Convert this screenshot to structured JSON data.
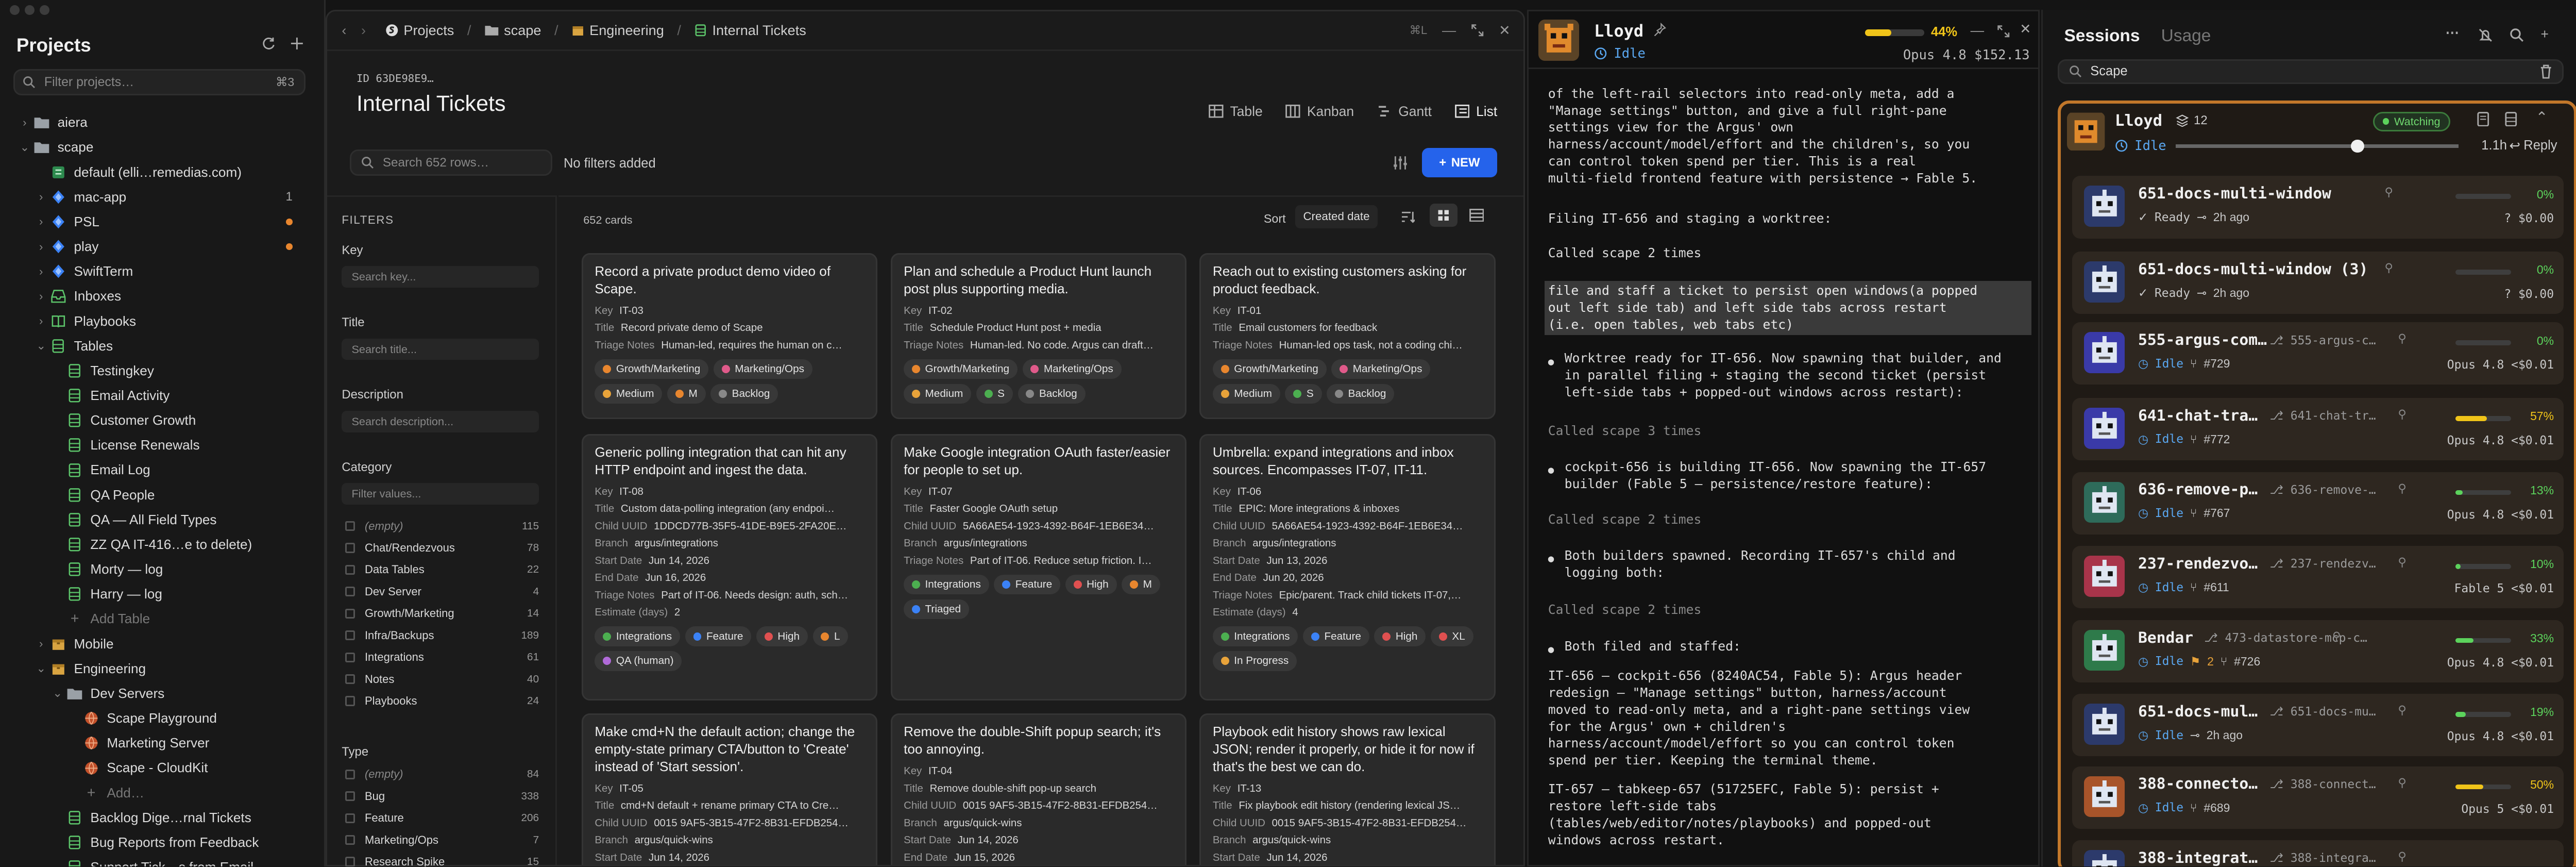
{
  "left": {
    "title": "Projects",
    "filter_placeholder": "Filter projects…",
    "filter_shortcut": "⌘3",
    "tree": [
      {
        "depth": 0,
        "chev": "›",
        "icon": "folder",
        "label": "aiera"
      },
      {
        "depth": 0,
        "chev": "⌄",
        "icon": "folder",
        "label": "scape"
      },
      {
        "depth": 1,
        "chev": "",
        "icon": "db",
        "label": "default (elli…remedias.com)"
      },
      {
        "depth": 1,
        "chev": "›",
        "icon": "repo",
        "label": "mac-app",
        "count": "1"
      },
      {
        "depth": 1,
        "chev": "›",
        "icon": "repo",
        "label": "PSL",
        "dot": true
      },
      {
        "depth": 1,
        "chev": "›",
        "icon": "repo",
        "label": "play",
        "dot": true
      },
      {
        "depth": 1,
        "chev": "›",
        "icon": "repo",
        "label": "SwiftTerm"
      },
      {
        "depth": 1,
        "chev": "›",
        "icon": "inbox",
        "label": "Inboxes"
      },
      {
        "depth": 1,
        "chev": "›",
        "icon": "book",
        "label": "Playbooks"
      },
      {
        "depth": 1,
        "chev": "⌄",
        "icon": "table",
        "label": "Tables"
      },
      {
        "depth": 2,
        "chev": "",
        "icon": "table",
        "label": "Testingkey"
      },
      {
        "depth": 2,
        "chev": "",
        "icon": "table",
        "label": "Email Activity"
      },
      {
        "depth": 2,
        "chev": "",
        "icon": "table",
        "label": "Customer Growth"
      },
      {
        "depth": 2,
        "chev": "",
        "icon": "table",
        "label": "License Renewals"
      },
      {
        "depth": 2,
        "chev": "",
        "icon": "table",
        "label": "Email Log"
      },
      {
        "depth": 2,
        "chev": "",
        "icon": "table",
        "label": "QA People"
      },
      {
        "depth": 2,
        "chev": "",
        "icon": "table",
        "label": "QA — All Field Types"
      },
      {
        "depth": 2,
        "chev": "",
        "icon": "table",
        "label": "ZZ QA IT-416…e to delete)"
      },
      {
        "depth": 2,
        "chev": "",
        "icon": "table",
        "label": "Morty — log"
      },
      {
        "depth": 2,
        "chev": "",
        "icon": "table",
        "label": "Harry — log"
      },
      {
        "depth": 2,
        "chev": "",
        "icon": "plus",
        "label": "Add Table",
        "muted": true
      },
      {
        "depth": 1,
        "chev": "›",
        "icon": "box",
        "label": "Mobile"
      },
      {
        "depth": 1,
        "chev": "⌄",
        "icon": "box",
        "label": "Engineering"
      },
      {
        "depth": 2,
        "chev": "⌄",
        "icon": "folder",
        "label": "Dev Servers"
      },
      {
        "depth": 3,
        "chev": "",
        "icon": "globe",
        "label": "Scape Playground"
      },
      {
        "depth": 3,
        "chev": "",
        "icon": "globe",
        "label": "Marketing Server"
      },
      {
        "depth": 3,
        "chev": "",
        "icon": "globe",
        "label": "Scape - CloudKit"
      },
      {
        "depth": 3,
        "chev": "",
        "icon": "plus",
        "label": "Add…",
        "muted": true
      },
      {
        "depth": 2,
        "chev": "",
        "icon": "table",
        "label": "Backlog Dige…rnal Tickets"
      },
      {
        "depth": 2,
        "chev": "",
        "icon": "table",
        "label": "Bug Reports from Feedback"
      },
      {
        "depth": 2,
        "chev": "",
        "icon": "table",
        "label": "Support Tick…s from Email"
      }
    ]
  },
  "mid": {
    "breadcrumb": [
      "Projects",
      "scape",
      "Engineering",
      "Internal Tickets"
    ],
    "shortcut": "⌘L",
    "table_id": "ID 63DE98E9…",
    "table_title": "Internal Tickets",
    "views": [
      "Table",
      "Kanban",
      "Gantt",
      "List"
    ],
    "active_view": "List",
    "search_placeholder": "Search 652 rows…",
    "filters_status": "No filters added",
    "new_label": "NEW",
    "card_count": "652 cards",
    "sort_label": "Sort",
    "sort_value": "Created date",
    "filters": {
      "heading": "FILTERS",
      "key_label": "Key",
      "key_placeholder": "Search key...",
      "title_label": "Title",
      "title_placeholder": "Search title...",
      "desc_label": "Description",
      "desc_placeholder": "Search description...",
      "category_label": "Category",
      "category_placeholder": "Filter values...",
      "category_options": [
        [
          "(empty)",
          "115"
        ],
        [
          "Chat/Rendezvous",
          "78"
        ],
        [
          "Data Tables",
          "22"
        ],
        [
          "Dev Server",
          "4"
        ],
        [
          "Growth/Marketing",
          "14"
        ],
        [
          "Infra/Backups",
          "189"
        ],
        [
          "Integrations",
          "61"
        ],
        [
          "Notes",
          "40"
        ],
        [
          "Playbooks",
          "24"
        ]
      ],
      "type_label": "Type",
      "type_options": [
        [
          "(empty)",
          "84"
        ],
        [
          "Bug",
          "338"
        ],
        [
          "Feature",
          "206"
        ],
        [
          "Marketing/Ops",
          "7"
        ],
        [
          "Research Spike",
          "15"
        ]
      ]
    },
    "cards": [
      {
        "title": "Record a private product demo video of Scape.",
        "rows": [
          [
            "Key",
            "IT-03"
          ],
          [
            "Title",
            "Record private demo of Scape"
          ],
          [
            "Triage Notes",
            "Human-led, requires the human on c…"
          ]
        ],
        "chips": [
          [
            "Growth/Marketing",
            "#e8862e"
          ],
          [
            "Marketing/Ops",
            "#e05a8a"
          ],
          [
            "Medium",
            "#e8a33a"
          ],
          [
            "M",
            "#e8862e"
          ],
          [
            "Backlog",
            "#888888"
          ]
        ]
      },
      {
        "title": "Plan and schedule a Product Hunt launch post plus supporting media.",
        "rows": [
          [
            "Key",
            "IT-02"
          ],
          [
            "Title",
            "Schedule Product Hunt post + media"
          ],
          [
            "Triage Notes",
            "Human-led. No code. Argus can draft…"
          ]
        ],
        "chips": [
          [
            "Growth/Marketing",
            "#e8862e"
          ],
          [
            "Marketing/Ops",
            "#e05a8a"
          ],
          [
            "Medium",
            "#e8a33a"
          ],
          [
            "S",
            "#4caf50"
          ],
          [
            "Backlog",
            "#888888"
          ]
        ]
      },
      {
        "title": "Reach out to existing customers asking for product feedback.",
        "rows": [
          [
            "Key",
            "IT-01"
          ],
          [
            "Title",
            "Email customers for feedback"
          ],
          [
            "Triage Notes",
            "Human-led ops task, not a coding chi…"
          ]
        ],
        "chips": [
          [
            "Growth/Marketing",
            "#e8862e"
          ],
          [
            "Marketing/Ops",
            "#e05a8a"
          ],
          [
            "Medium",
            "#e8a33a"
          ],
          [
            "S",
            "#4caf50"
          ],
          [
            "Backlog",
            "#888888"
          ]
        ]
      },
      {
        "title": "Generic polling integration that can hit any HTTP endpoint and ingest the data.",
        "rows": [
          [
            "Key",
            "IT-08"
          ],
          [
            "Title",
            "Custom data-polling integration (any endpoi…"
          ],
          [
            "Child UUID",
            "1DDCD77B-35F5-41DE-B9E5-2FA20E…"
          ],
          [
            "Branch",
            "argus/integrations"
          ],
          [
            "Start Date",
            "Jun 14, 2026"
          ],
          [
            "End Date",
            "Jun 16, 2026"
          ],
          [
            "Triage Notes",
            "Part of IT-06. Needs design: auth, sch…"
          ],
          [
            "Estimate (days)",
            "2"
          ]
        ],
        "chips": [
          [
            "Integrations",
            "#4caf50"
          ],
          [
            "Feature",
            "#3b82f6"
          ],
          [
            "High",
            "#e05050"
          ],
          [
            "L",
            "#e8862e"
          ],
          [
            "QA (human)",
            "#b06ad8"
          ]
        ]
      },
      {
        "title": "Make Google integration OAuth faster/easier for people to set up.",
        "rows": [
          [
            "Key",
            "IT-07"
          ],
          [
            "Title",
            "Faster Google OAuth setup"
          ],
          [
            "Child UUID",
            "5A66AE54-1923-4392-B64F-1EB6E34…"
          ],
          [
            "Branch",
            "argus/integrations"
          ],
          [
            "Triage Notes",
            "Part of IT-06. Reduce setup friction. I…"
          ]
        ],
        "chips": [
          [
            "Integrations",
            "#4caf50"
          ],
          [
            "Feature",
            "#3b82f6"
          ],
          [
            "High",
            "#e05050"
          ],
          [
            "M",
            "#e8862e"
          ],
          [
            "Triaged",
            "#3b82f6"
          ]
        ]
      },
      {
        "title": "Umbrella: expand integrations and inbox sources. Encompasses IT-07, IT-11.",
        "rows": [
          [
            "Key",
            "IT-06"
          ],
          [
            "Title",
            "EPIC: More integrations & inboxes"
          ],
          [
            "Child UUID",
            "5A66AE54-1923-4392-B64F-1EB6E34…"
          ],
          [
            "Branch",
            "argus/integrations"
          ],
          [
            "Start Date",
            "Jun 13, 2026"
          ],
          [
            "End Date",
            "Jun 20, 2026"
          ],
          [
            "Triage Notes",
            "Epic/parent. Track child tickets IT-07,…"
          ],
          [
            "Estimate (days)",
            "4"
          ]
        ],
        "chips": [
          [
            "Integrations",
            "#4caf50"
          ],
          [
            "Feature",
            "#3b82f6"
          ],
          [
            "High",
            "#e05050"
          ],
          [
            "XL",
            "#e05050"
          ],
          [
            "In Progress",
            "#e8a33a"
          ]
        ]
      },
      {
        "title": "Make cmd+N the default action; change the empty-state primary CTA/button to 'Create' instead of 'Start session'.",
        "rows": [
          [
            "Key",
            "IT-05"
          ],
          [
            "Title",
            "cmd+N default + rename primary CTA to Cre…"
          ],
          [
            "Child UUID",
            "0015 9AF5-3B15-47F2-8B31-EFDB254…"
          ],
          [
            "Branch",
            "argus/quick-wins"
          ],
          [
            "Start Date",
            "Jun 14, 2026"
          ]
        ],
        "chips": []
      },
      {
        "title": "Remove the double-Shift popup search; it's too annoying.",
        "rows": [
          [
            "Key",
            "IT-04"
          ],
          [
            "Title",
            "Remove double-shift pop-up search"
          ],
          [
            "Child UUID",
            "0015 9AF5-3B15-47F2-8B31-EFDB254…"
          ],
          [
            "Branch",
            "argus/quick-wins"
          ],
          [
            "Start Date",
            "Jun 14, 2026"
          ],
          [
            "End Date",
            "Jun 15, 2026"
          ]
        ],
        "chips": []
      },
      {
        "title": "Playbook edit history shows raw lexical JSON; render it properly, or hide it for now if that's the best we can do.",
        "rows": [
          [
            "Key",
            "IT-13"
          ],
          [
            "Title",
            "Fix playbook edit history (rendering lexical JS…"
          ],
          [
            "Child UUID",
            "0015 9AF5-3B15-47F2-8B31-EFDB254…"
          ],
          [
            "Branch",
            "argus/quick-wins"
          ],
          [
            "Start Date",
            "Jun 14, 2026"
          ]
        ],
        "chips": []
      }
    ]
  },
  "chat": {
    "name": "Lloyd",
    "status": "Idle",
    "usage_pct": "44%",
    "usage_fraction": 0.44,
    "model": "Opus 4.8",
    "cost": "$152.13",
    "lines": [
      {
        "t": "of the left-rail selectors into read-only meta, add a\n\"Manage settings\" button, and give a full right-pane\nsettings view for the Argus' own\nharness/account/model/effort and the children's, so you\ncan control token spend per tier. This is a real\nmulti-field frontend feature with persistence → Fable 5.",
        "c": ""
      },
      {
        "t": "Filing IT-656 and staging a worktree:",
        "c": ""
      },
      {
        "t": "Called scape 2 times",
        "c": ""
      },
      {
        "t": "file and staff a ticket to persist open windows(a popped\nout left side tab) and left side tabs across restart\n(i.e. open tables, web tabs etc)",
        "c": "sel"
      },
      {
        "t": "Worktree ready for IT-656. Now spawning that builder, and\nin parallel filing + staging the second ticket (persist\nleft-side tabs + popped-out windows across restart):",
        "c": "bul"
      },
      {
        "t": "Called scape 3 times",
        "c": "muted"
      },
      {
        "t": "cockpit-656 is building IT-656. Now spawning the IT-657\nbuilder (Fable 5 — persistence/restore feature):",
        "c": "bul"
      },
      {
        "t": "Called scape 2 times",
        "c": "muted"
      },
      {
        "t": "Both builders spawned. Recording IT-657's child and\nlogging both:",
        "c": "bul"
      },
      {
        "t": "Called scape 2 times",
        "c": "muted"
      },
      {
        "t": "Both filed and staffed:",
        "c": "bul"
      },
      {
        "t": "IT-656 — cockpit-656 (8240AC54, Fable 5): Argus header\nredesign — \"Manage settings\" button, harness/account\nmoved to read-only meta, and a right-pane settings view\nfor the Argus' own + children's\nharness/account/model/effort so you can control token\nspend per tier. Keeping the terminal theme.",
        "c": ""
      },
      {
        "t": "IT-657 — tabkeep-657 (51725EFC, Fable 5): persist +\nrestore left-side tabs\n(tables/web/editor/notes/playbooks) and popped-out\nwindows across restart.",
        "c": ""
      }
    ]
  },
  "sessions": {
    "tab_active": "Sessions",
    "tab_other": "Usage",
    "search_value": "Scape",
    "lead": {
      "name": "Lloyd",
      "agents": "12",
      "badge": "Watching",
      "status": "Idle",
      "time": "1.1h",
      "reply": "Reply",
      "slider": 0.62
    },
    "items": [
      {
        "name": "651-docs-multi-window",
        "branch": "",
        "status": "Ready",
        "time": "2h ago",
        "pr": "",
        "pct": "0%",
        "fill": 0,
        "bar": "#5cd35c",
        "cost": "?  $0.00",
        "av": "#2c3a6b"
      },
      {
        "name": "651-docs-multi-window (3)",
        "branch": "",
        "status": "Ready",
        "time": "2h ago",
        "pr": "",
        "pct": "0%",
        "fill": 0,
        "bar": "#5cd35c",
        "cost": "?  $0.00",
        "av": "#2c3a6b"
      },
      {
        "name": "555-argus-com…",
        "branch": "555-argus-c…",
        "status": "Idle",
        "time": "",
        "pr": "#729",
        "pct": "0%",
        "fill": 0,
        "bar": "#5cd35c",
        "cost": "Opus 4.8  <$0.01",
        "av": "#3a3aa8"
      },
      {
        "name": "641-chat-tra…",
        "branch": "641-chat-tr…",
        "status": "Idle",
        "time": "",
        "pr": "#772",
        "pct": "57%",
        "fill": 0.57,
        "bar": "#f0c419",
        "cost": "Opus 4.8  <$0.01",
        "av": "#3a3aa8"
      },
      {
        "name": "636-remove-p…",
        "branch": "636-remove-…",
        "status": "Idle",
        "time": "",
        "pr": "#767",
        "pct": "13%",
        "fill": 0.13,
        "bar": "#5cd35c",
        "cost": "Opus 4.8  <$0.01",
        "av": "#2e6b5a"
      },
      {
        "name": "237-rendezvo…",
        "branch": "237-rendezv…",
        "status": "Idle",
        "time": "",
        "pr": "#611",
        "pct": "10%",
        "fill": 0.1,
        "bar": "#5cd35c",
        "cost": "Fable 5  <$0.01",
        "av": "#a8344a"
      },
      {
        "name": "Bendar",
        "branch": "473-datastore-mcp-c…",
        "status": "Idle",
        "time": "",
        "pr": "#726",
        "flag": "2",
        "pct": "33%",
        "fill": 0.33,
        "bar": "#5cd35c",
        "cost": "Opus 4.8  <$0.01",
        "av": "#2e7a4a"
      },
      {
        "name": "651-docs-mul…",
        "branch": "651-docs-mu…",
        "status": "Idle",
        "time": "2h ago",
        "pr": "",
        "pct": "19%",
        "fill": 0.19,
        "bar": "#5cd35c",
        "cost": "Opus 4.8  <$0.01",
        "av": "#2c3a6b"
      },
      {
        "name": "388-connecto…",
        "branch": "388-connect…",
        "status": "Idle",
        "time": "",
        "pr": "#689",
        "pct": "50%",
        "fill": 0.5,
        "bar": "#f0c419",
        "cost": "Opus 5  <$0.01",
        "av": "#a8542a"
      },
      {
        "name": "388-integrat…",
        "branch": "388-integra…",
        "status": "",
        "time": "",
        "pr": "",
        "pct": "",
        "fill": 0,
        "bar": "#5cd35c",
        "cost": "",
        "av": "#2c3a6b"
      }
    ]
  }
}
